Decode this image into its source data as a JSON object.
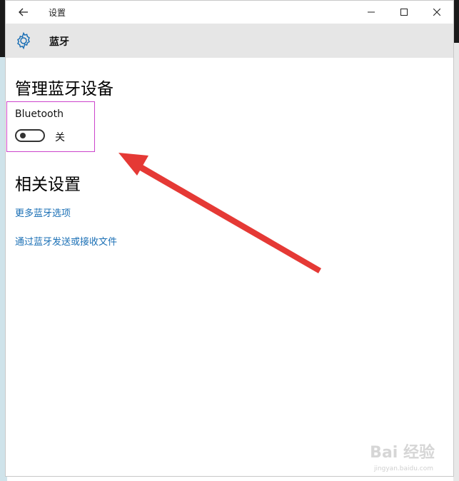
{
  "titlebar": {
    "title": "设置"
  },
  "header": {
    "title": "蓝牙"
  },
  "main": {
    "section_title": "管理蓝牙设备",
    "bluetooth": {
      "label": "Bluetooth",
      "toggle_state": "关",
      "enabled": false
    },
    "related_title": "相关设置",
    "links": [
      "更多蓝牙选项",
      "通过蓝牙发送或接收文件"
    ]
  },
  "watermark": {
    "brand": "Bai 经验",
    "url": "jingyan.baidu.com"
  },
  "colors": {
    "link": "#1a6fb5",
    "header_bg": "#e6e6e6",
    "highlight_border": "#cc44cc",
    "arrow": "#e53935"
  },
  "icons": {
    "back": "back-arrow-icon",
    "gear": "gear-icon",
    "minimize": "minimize-icon",
    "maximize": "maximize-icon",
    "close": "close-icon"
  }
}
